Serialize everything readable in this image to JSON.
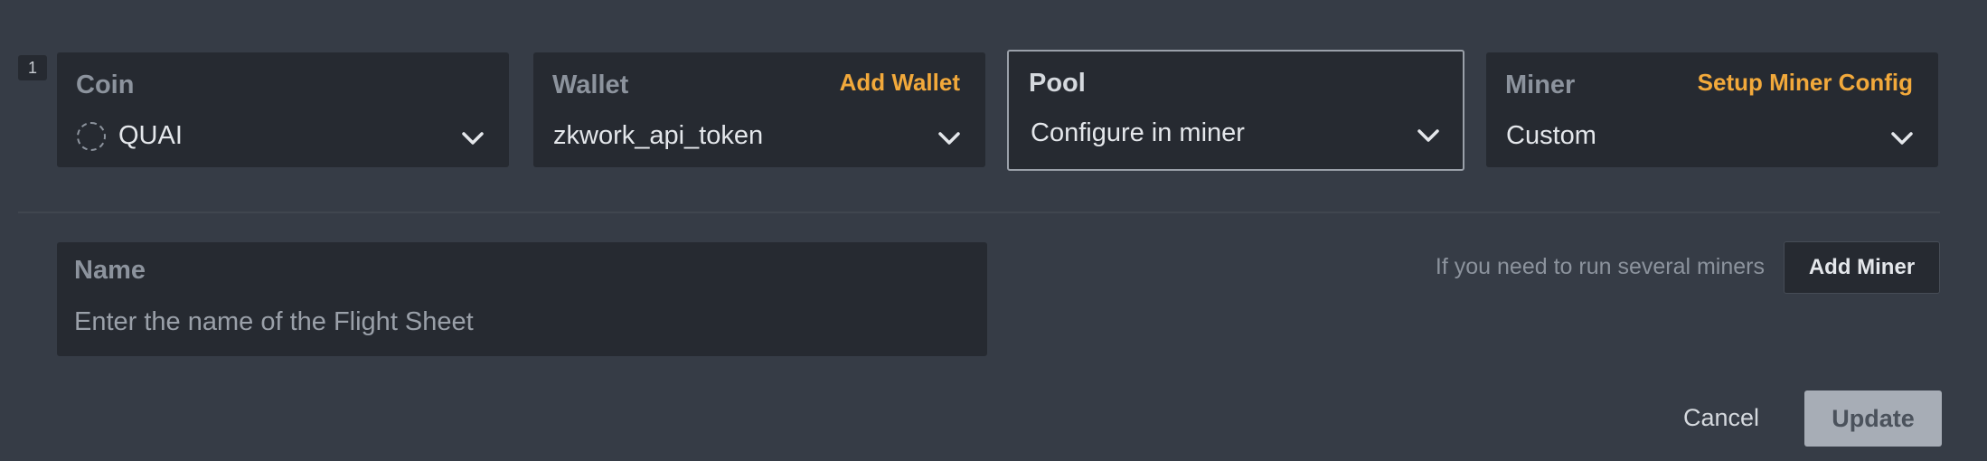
{
  "row_index": "1",
  "coin": {
    "label": "Coin",
    "value": "QUAI",
    "icon": "coin-placeholder-icon"
  },
  "wallet": {
    "label": "Wallet",
    "action": "Add Wallet",
    "value": "zkwork_api_token"
  },
  "pool": {
    "label": "Pool",
    "value": "Configure in miner"
  },
  "miner": {
    "label": "Miner",
    "action": "Setup Miner Config",
    "value": "Custom"
  },
  "name": {
    "label": "Name",
    "value": "",
    "placeholder": "Enter the name of the Flight Sheet"
  },
  "hint": "If you need to run several miners",
  "add_miner_label": "Add Miner",
  "cancel_label": "Cancel",
  "update_label": "Update",
  "colors": {
    "background": "#363c46",
    "card": "#262a31",
    "accent": "#f2a93b",
    "update_button": "#a7adb6"
  }
}
